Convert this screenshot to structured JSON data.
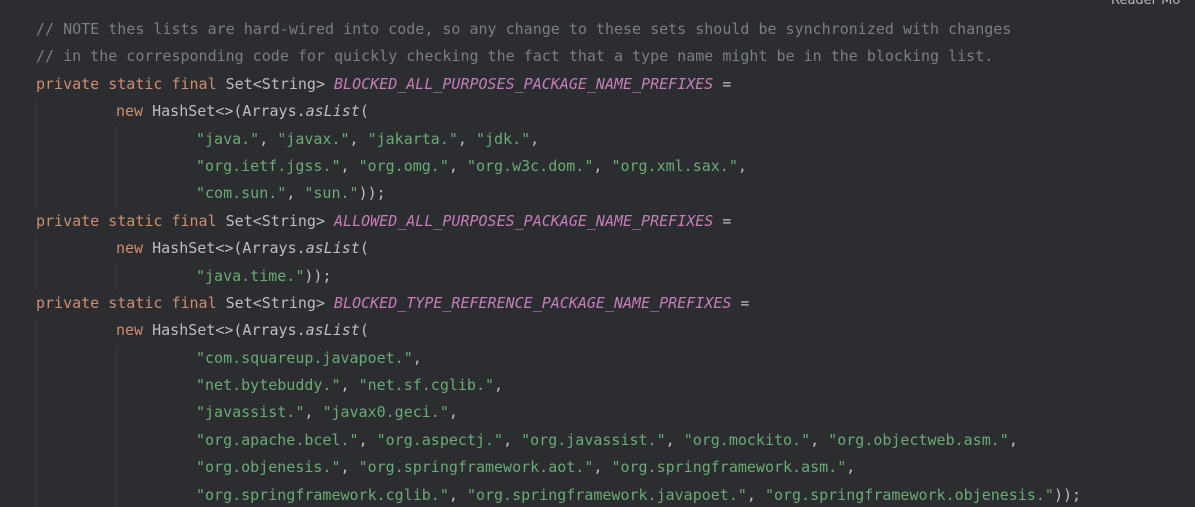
{
  "reader_mode": {
    "label": "Reader Mo"
  },
  "code": {
    "comment1": "// NOTE thes lists are hard-wired into code, so any change to these sets should be synchronized with changes",
    "comment2": "// in the corresponding code for quickly checking the fact that a type name might be in the blocking list.",
    "kw_private": "private",
    "kw_static": "static",
    "kw_final": "final",
    "kw_new": "new",
    "type_set": "Set<String>",
    "hashset_open": "HashSet<>(Arrays.",
    "as_list": "asList",
    "paren_open": "(",
    "assign": " =",
    "field1": "BLOCKED_ALL_PURPOSES_PACKAGE_NAME_PREFIXES",
    "field2": "ALLOWED_ALL_PURPOSES_PACKAGE_NAME_PREFIXES",
    "field3": "BLOCKED_TYPE_REFERENCE_PACKAGE_NAME_PREFIXES",
    "list1": [
      [
        "\"java.\"",
        "\"javax.\"",
        "\"jakarta.\"",
        "\"jdk.\""
      ],
      [
        "\"org.ietf.jgss.\"",
        "\"org.omg.\"",
        "\"org.w3c.dom.\"",
        "\"org.xml.sax.\""
      ],
      [
        "\"com.sun.\"",
        "\"sun.\""
      ]
    ],
    "list2": [
      [
        "\"java.time.\""
      ]
    ],
    "list3": [
      [
        "\"com.squareup.javapoet.\""
      ],
      [
        "\"net.bytebuddy.\"",
        "\"net.sf.cglib.\""
      ],
      [
        "\"javassist.\"",
        "\"javax0.geci.\""
      ],
      [
        "\"org.apache.bcel.\"",
        "\"org.aspectj.\"",
        "\"org.javassist.\"",
        "\"org.mockito.\"",
        "\"org.objectweb.asm.\""
      ],
      [
        "\"org.objenesis.\"",
        "\"org.springframework.aot.\"",
        "\"org.springframework.asm.\""
      ],
      [
        "\"org.springframework.cglib.\"",
        "\"org.springframework.javapoet.\"",
        "\"org.springframework.objenesis.\""
      ]
    ],
    "close_cont": ",",
    "close_end": "));"
  }
}
